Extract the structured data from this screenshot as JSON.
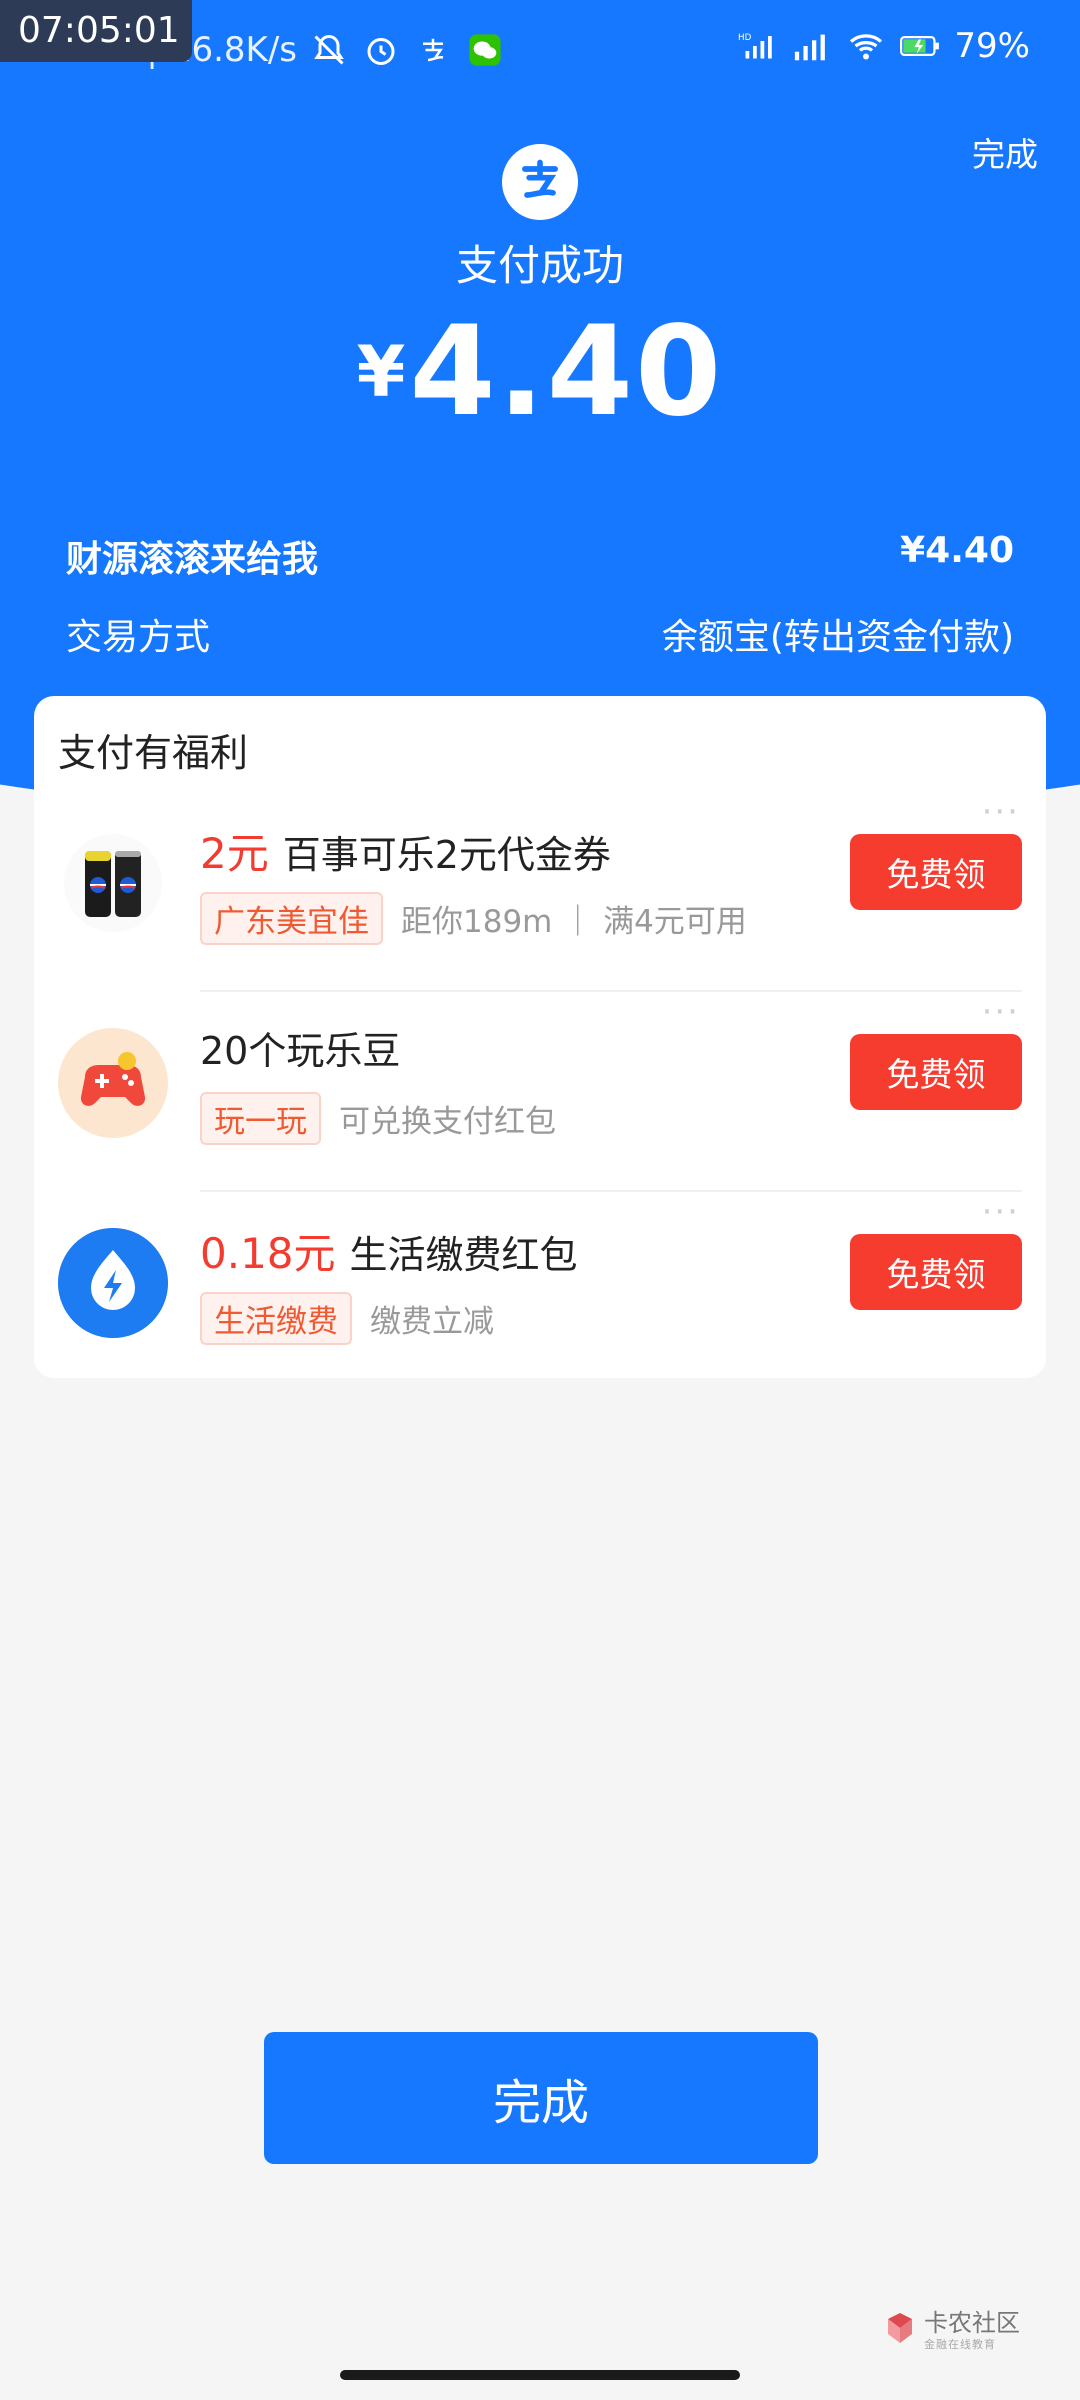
{
  "status_bar": {
    "overlay_clock": "07:05:01",
    "time": "7:05",
    "speed": "16.8K/s",
    "battery": "79%"
  },
  "header": {
    "done_label": "完成",
    "title": "支付成功",
    "currency": "¥",
    "amount": "4.40"
  },
  "details": {
    "payee": "财源滚滚来给我",
    "payee_amount": "¥4.40",
    "method_label": "交易方式",
    "method_value": "余额宝(转出资金付款)"
  },
  "benefits": {
    "title": "支付有福利",
    "items": [
      {
        "highlight": "2元",
        "name": "百事可乐2元代金券",
        "tag": "广东美宜佳",
        "note": "距你189m ｜ 满4元可用",
        "button": "免费领",
        "icon": "cola-cans-icon"
      },
      {
        "highlight": "",
        "name": "20个玩乐豆",
        "tag": "玩一玩",
        "note": "可兑换支付红包",
        "button": "免费领",
        "icon": "gamepad-icon"
      },
      {
        "highlight": "0.18元",
        "name": "生活缴费红包",
        "tag": "生活缴费",
        "note": "缴费立减",
        "button": "免费领",
        "icon": "lightning-drop-icon"
      }
    ]
  },
  "footer": {
    "done_button": "完成",
    "watermark": "卡农社区",
    "watermark_sub": "金融在线教育"
  },
  "colors": {
    "brand_blue": "#1678ff",
    "accent_red": "#f63b2f",
    "tag_orange": "#f05a33"
  }
}
